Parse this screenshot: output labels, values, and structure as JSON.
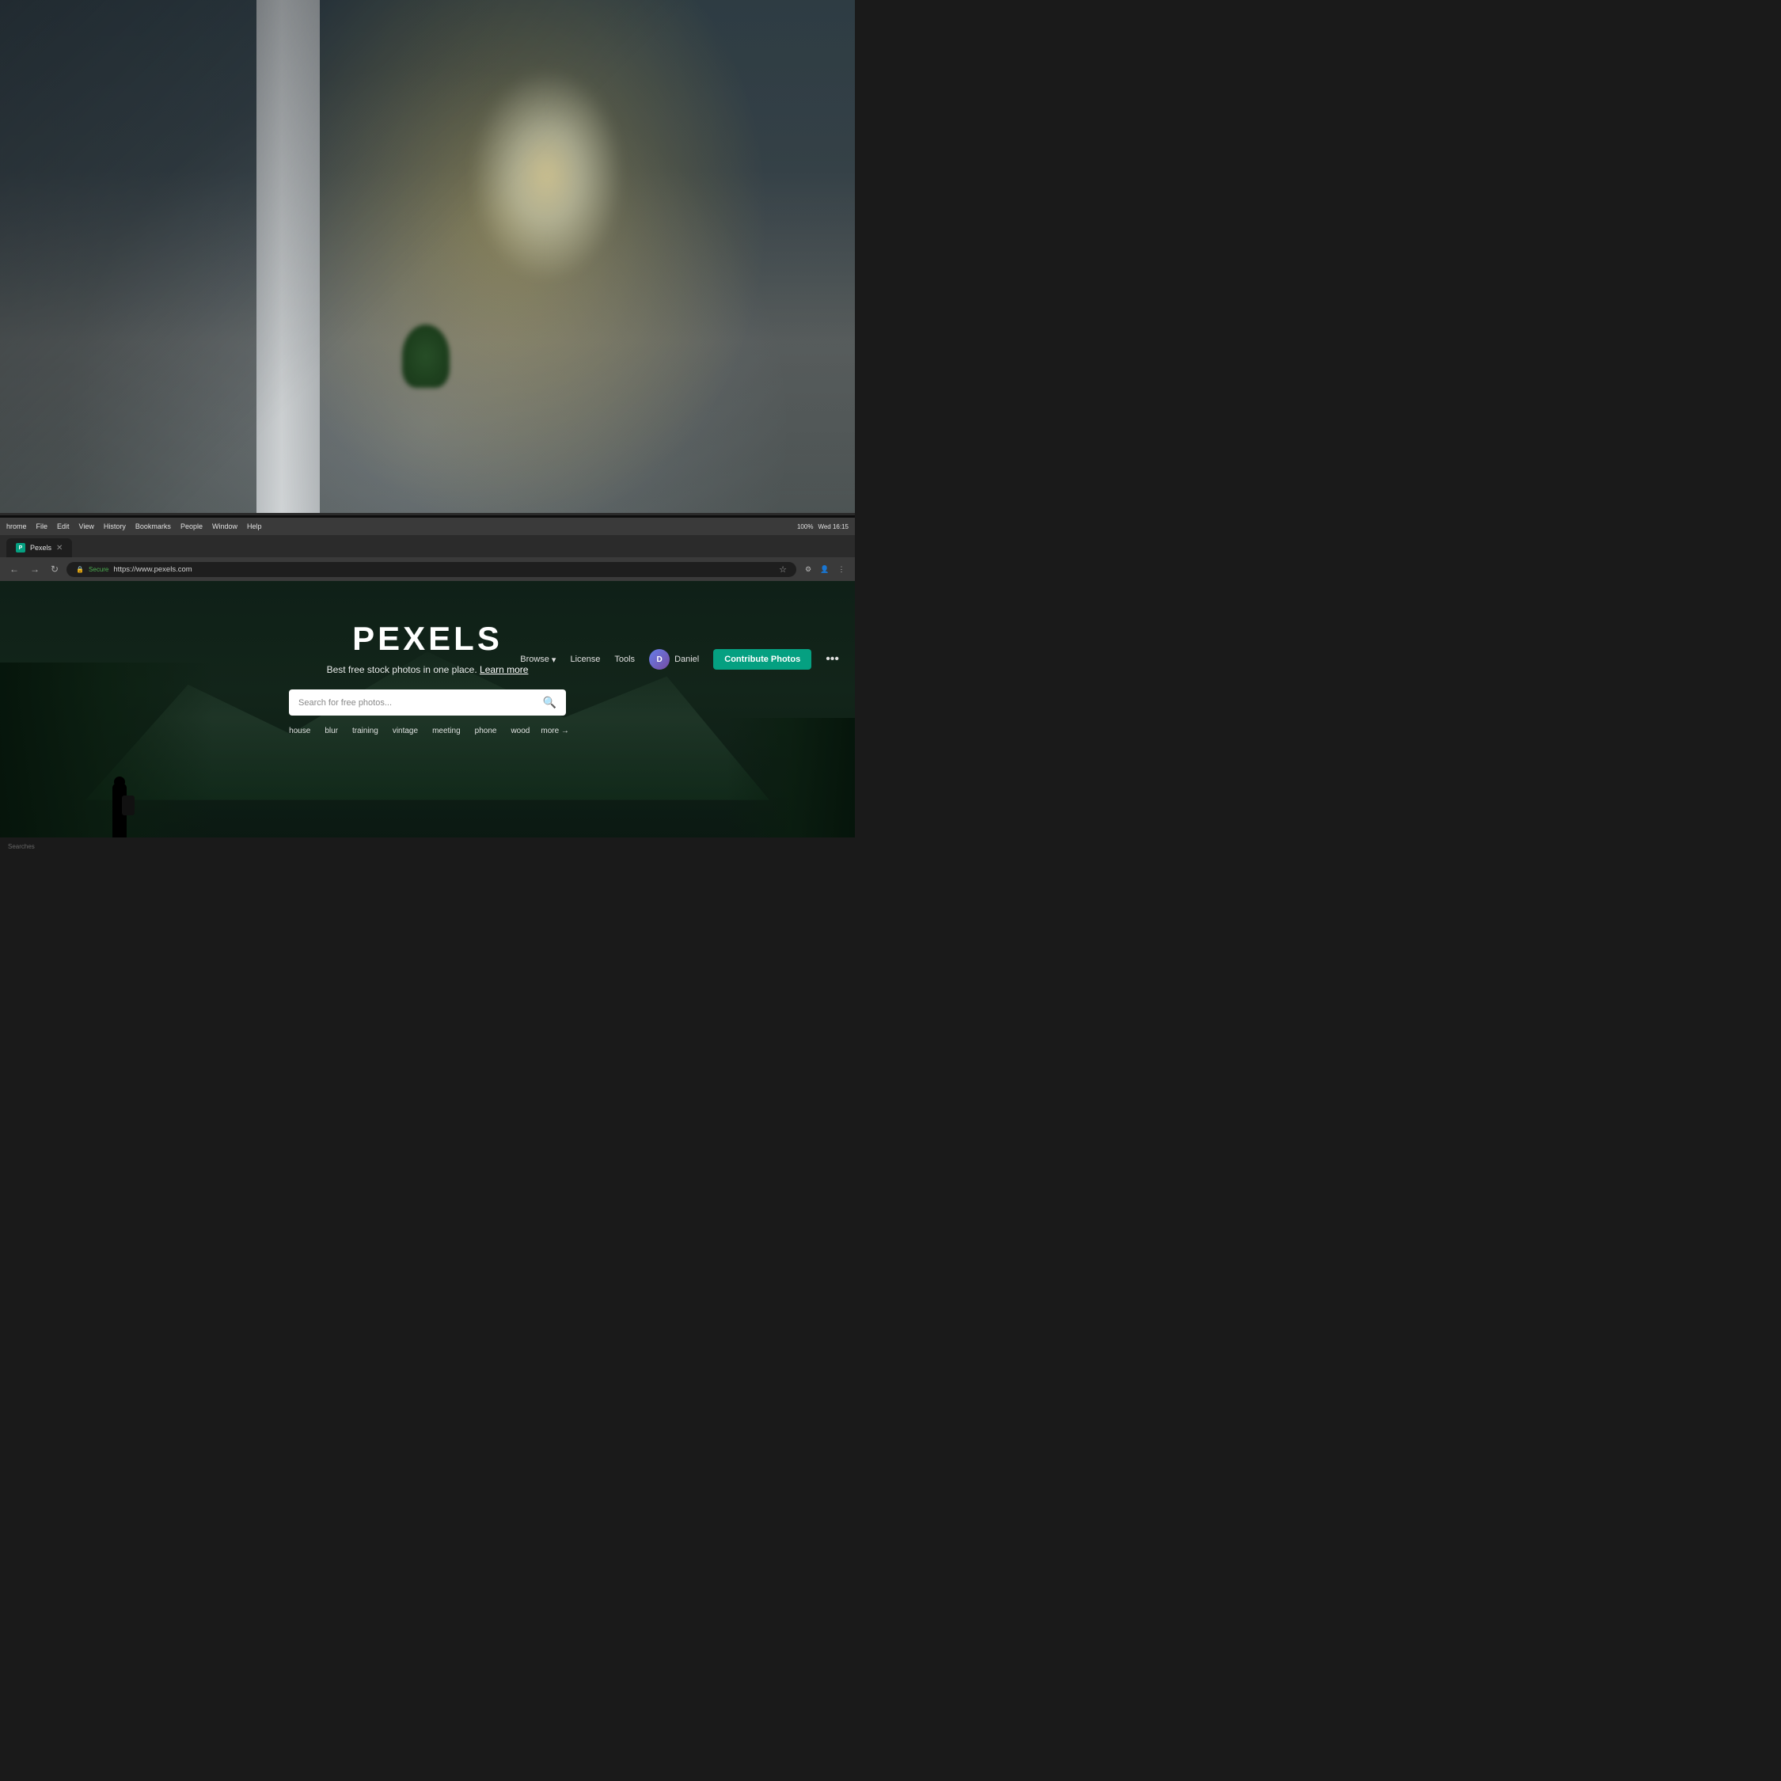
{
  "background": {
    "description": "Office space with bokeh background - blurred modern workspace with plants and windows"
  },
  "browser": {
    "menu_items": [
      "hrome",
      "File",
      "Edit",
      "View",
      "History",
      "Bookmarks",
      "People",
      "Window",
      "Help"
    ],
    "status_right": "Wed 16:15",
    "battery": "100%",
    "tab": {
      "title": "Pexels",
      "favicon_color": "#05a081"
    },
    "address": {
      "secure_label": "Secure",
      "url": "https://www.pexels.com",
      "close_icon": "✕"
    }
  },
  "pexels": {
    "logo": "PEXELS",
    "tagline": "Best free stock photos in one place.",
    "learn_more": "Learn more",
    "search_placeholder": "Search for free photos...",
    "nav": {
      "browse": "Browse",
      "license": "License",
      "tools": "Tools",
      "user_name": "Daniel",
      "contribute_btn": "Contribute Photos"
    },
    "suggestions": [
      "house",
      "blur",
      "training",
      "vintage",
      "meeting",
      "phone",
      "wood",
      "more →"
    ]
  },
  "footer": {
    "label": "Searches"
  },
  "icons": {
    "search": "🔍",
    "chevron_down": "▾",
    "lock": "🔒",
    "star": "☆",
    "back": "←",
    "forward": "→",
    "refresh": "↻",
    "more_dots": "•••"
  }
}
